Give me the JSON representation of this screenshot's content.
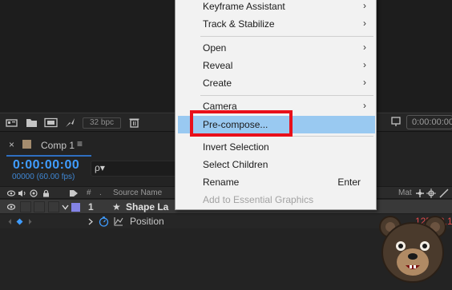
{
  "toolbar": {
    "bpc_label": "32 bpc",
    "timecode_field": "0:00:00:00"
  },
  "comp_tab": {
    "close_glyph": "×",
    "label": "Comp 1",
    "menu_glyph": "≡",
    "swatch_color": "#a48c6e"
  },
  "timecode": {
    "value": "0:00:00:00",
    "frames": "00000 (60.00 fps)",
    "color": "#3f9cff"
  },
  "search": {
    "glyph": "ρ▾"
  },
  "columns": {
    "hash": "#",
    "source_name": "Source Name",
    "mat": "Mat"
  },
  "layer": {
    "number": "1",
    "star": "★",
    "name": "Shape La",
    "label_color": "#8484e6"
  },
  "property": {
    "name": "Position",
    "value": "1252.0,1",
    "value_color": "#e04a4a"
  },
  "context_menu": {
    "items": [
      {
        "label": "Keyframe Assistant",
        "submenu": true
      },
      {
        "label": "Track & Stabilize",
        "submenu": true
      },
      {
        "label": "Open",
        "submenu": true
      },
      {
        "label": "Reveal",
        "submenu": true
      },
      {
        "label": "Create",
        "submenu": true
      },
      {
        "label": "Camera",
        "submenu": true
      },
      {
        "label": "Pre-compose...",
        "highlighted": true
      },
      {
        "label": "Invert Selection"
      },
      {
        "label": "Select Children"
      },
      {
        "label": "Rename",
        "shortcut": "Enter"
      },
      {
        "label": "Add to Essential Graphics",
        "disabled": true
      }
    ],
    "submenu_arrow": "›",
    "highlight_color": "#99c9f1",
    "callout_color": "#e8101b"
  }
}
